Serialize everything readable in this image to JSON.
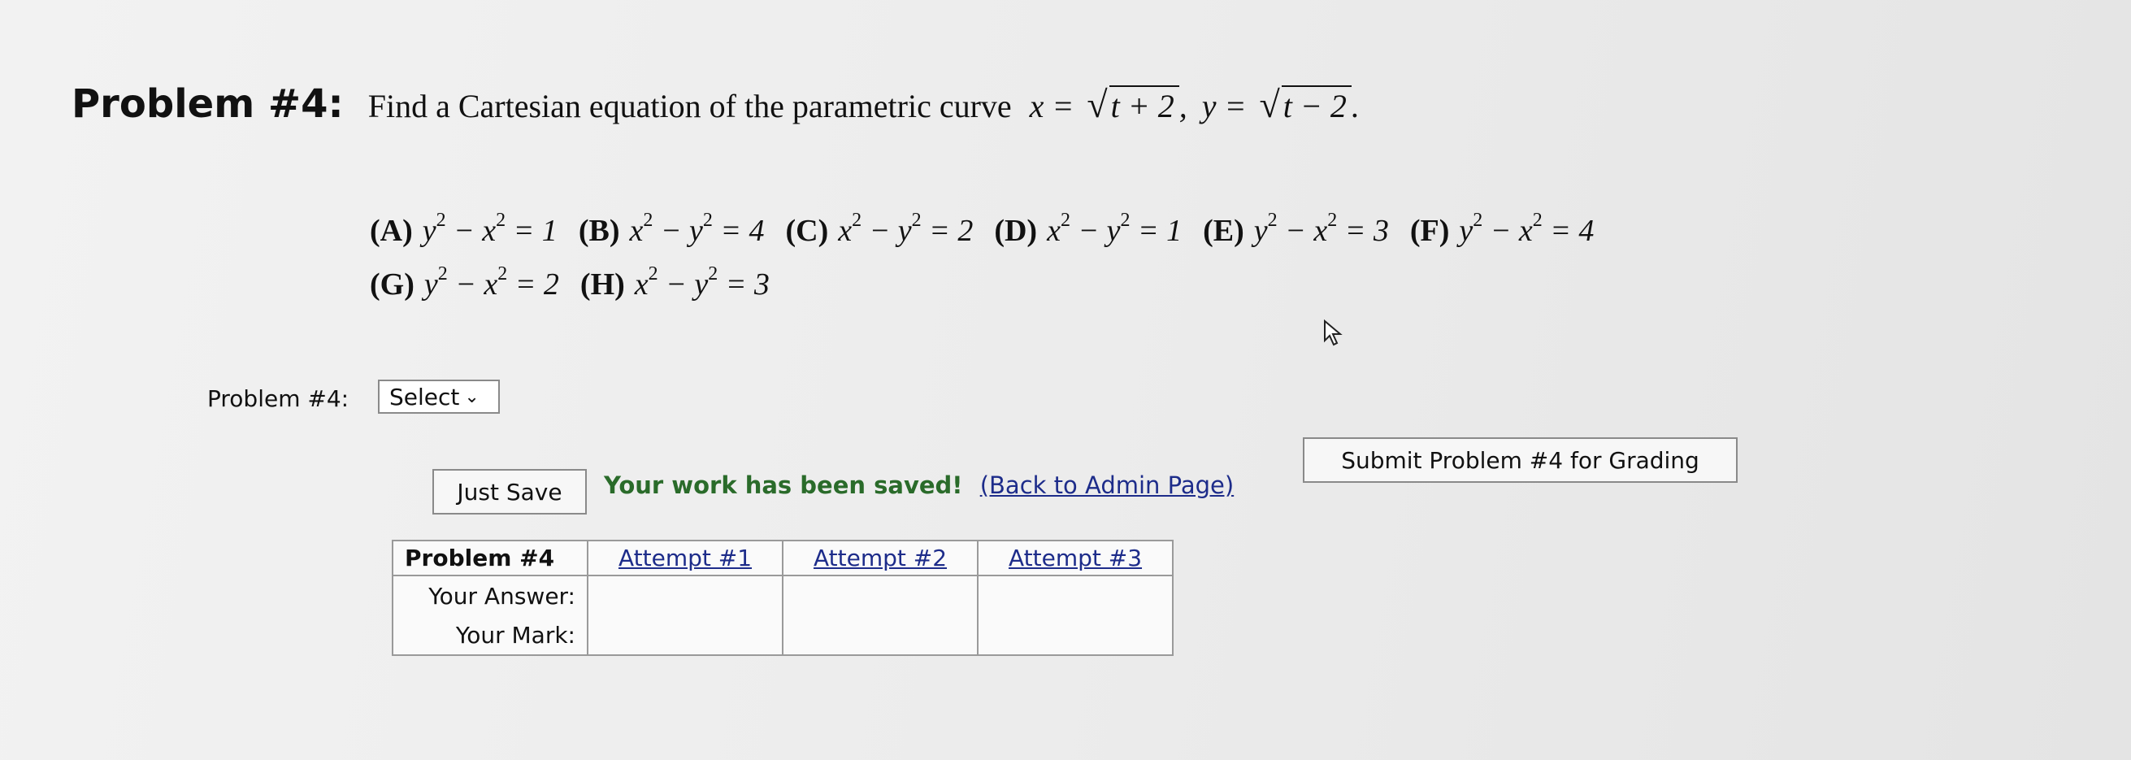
{
  "problem": {
    "heading": "Problem #4:",
    "statement": "Find a Cartesian equation of the parametric curve",
    "x_var": "x =",
    "x_radicand": "t + 2",
    "sep": ",",
    "y_var": "y =",
    "y_radicand": "t − 2",
    "end": "."
  },
  "choices": [
    {
      "letter": "(A)",
      "lhs": "y",
      "mid": " − x",
      "rhs": " = 1"
    },
    {
      "letter": "(B)",
      "lhs": "x",
      "mid": " − y",
      "rhs": " = 4"
    },
    {
      "letter": "(C)",
      "lhs": "x",
      "mid": " − y",
      "rhs": " = 2"
    },
    {
      "letter": "(D)",
      "lhs": "x",
      "mid": " − y",
      "rhs": " = 1"
    },
    {
      "letter": "(E)",
      "lhs": "y",
      "mid": " − x",
      "rhs": " = 3"
    },
    {
      "letter": "(F)",
      "lhs": "y",
      "mid": " − x",
      "rhs": " = 4"
    },
    {
      "letter": "(G)",
      "lhs": "y",
      "mid": " − x",
      "rhs": " = 2"
    },
    {
      "letter": "(H)",
      "lhs": "x",
      "mid": " − y",
      "rhs": " = 3"
    }
  ],
  "exponent": "2",
  "answer": {
    "label": "Problem #4:",
    "select_value": "Select",
    "chevron_glyph": "⌄"
  },
  "actions": {
    "just_save": "Just Save",
    "saved_message": "Your work has been saved!",
    "admin_link": "(Back to Admin Page)",
    "submit": "Submit Problem #4 for Grading"
  },
  "attempts_table": {
    "header": "Problem #4",
    "attempts": [
      "Attempt #1",
      "Attempt #2",
      "Attempt #3"
    ],
    "row_labels": [
      "Your Answer:",
      "Your Mark:"
    ]
  }
}
